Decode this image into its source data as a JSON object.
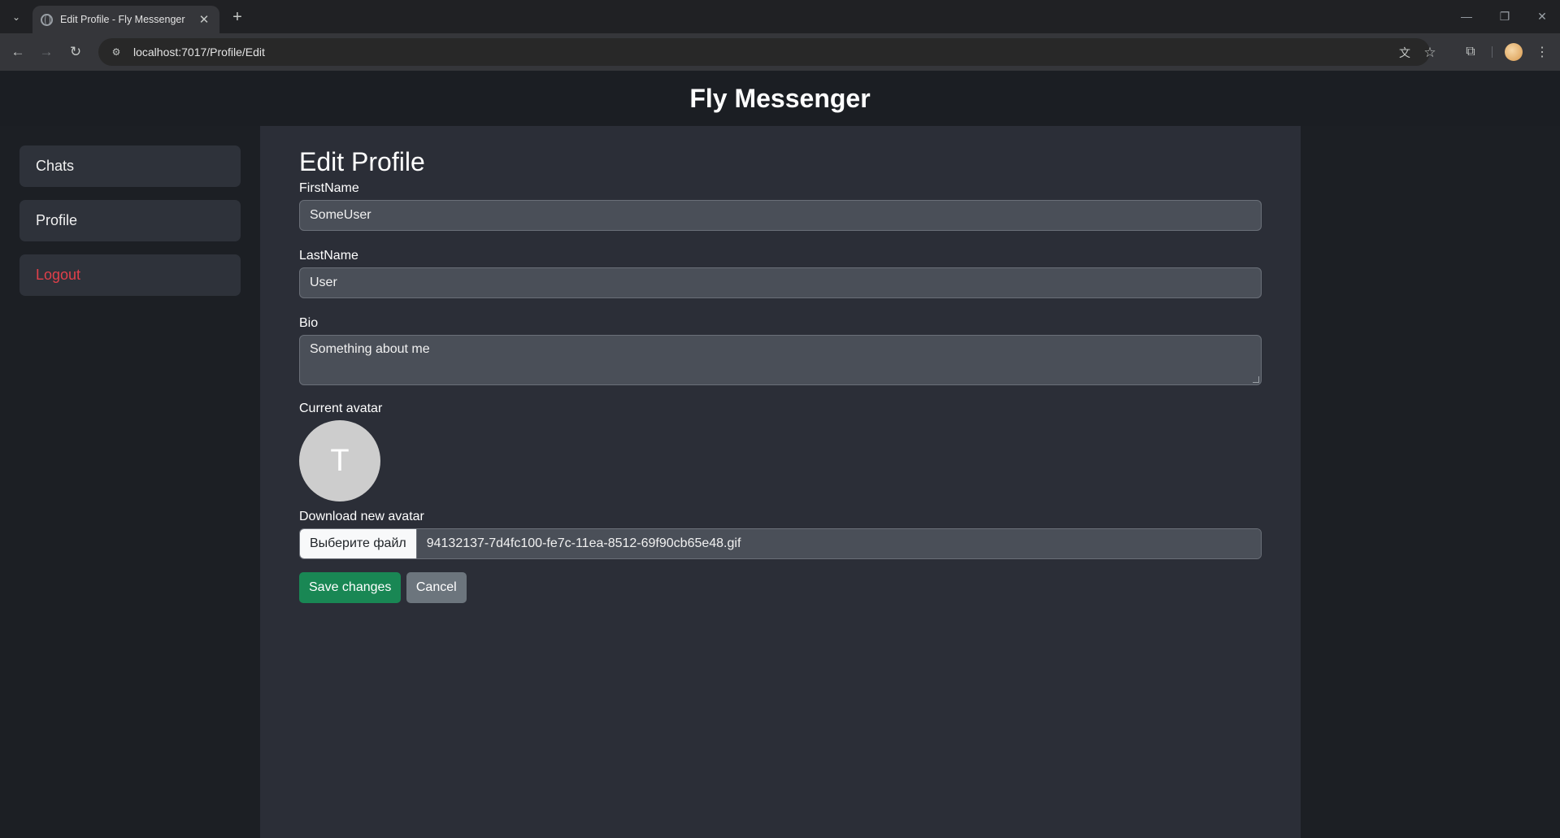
{
  "browser": {
    "tab_title": "Edit Profile - Fly Messenger",
    "url": "localhost:7017/Profile/Edit"
  },
  "site": {
    "title": "Fly Messenger"
  },
  "sidebar": {
    "items": [
      {
        "label": "Chats"
      },
      {
        "label": "Profile"
      },
      {
        "label": "Logout"
      }
    ]
  },
  "form": {
    "heading": "Edit Profile",
    "first_name_label": "FirstName",
    "first_name_value": "SomeUser",
    "last_name_label": "LastName",
    "last_name_value": "User",
    "bio_label": "Bio",
    "bio_value": "Something about me",
    "current_avatar_label": "Current avatar",
    "avatar_initial": "T",
    "new_avatar_label": "Download new avatar",
    "file_button_label": "Выберите файл",
    "file_name": "94132137-7d4fc100-fe7c-11ea-8512-69f90cb65e48.gif",
    "save_label": "Save changes",
    "cancel_label": "Cancel"
  },
  "colors": {
    "logout": "#e0404a",
    "save": "#198754",
    "cancel": "#6c757d"
  }
}
